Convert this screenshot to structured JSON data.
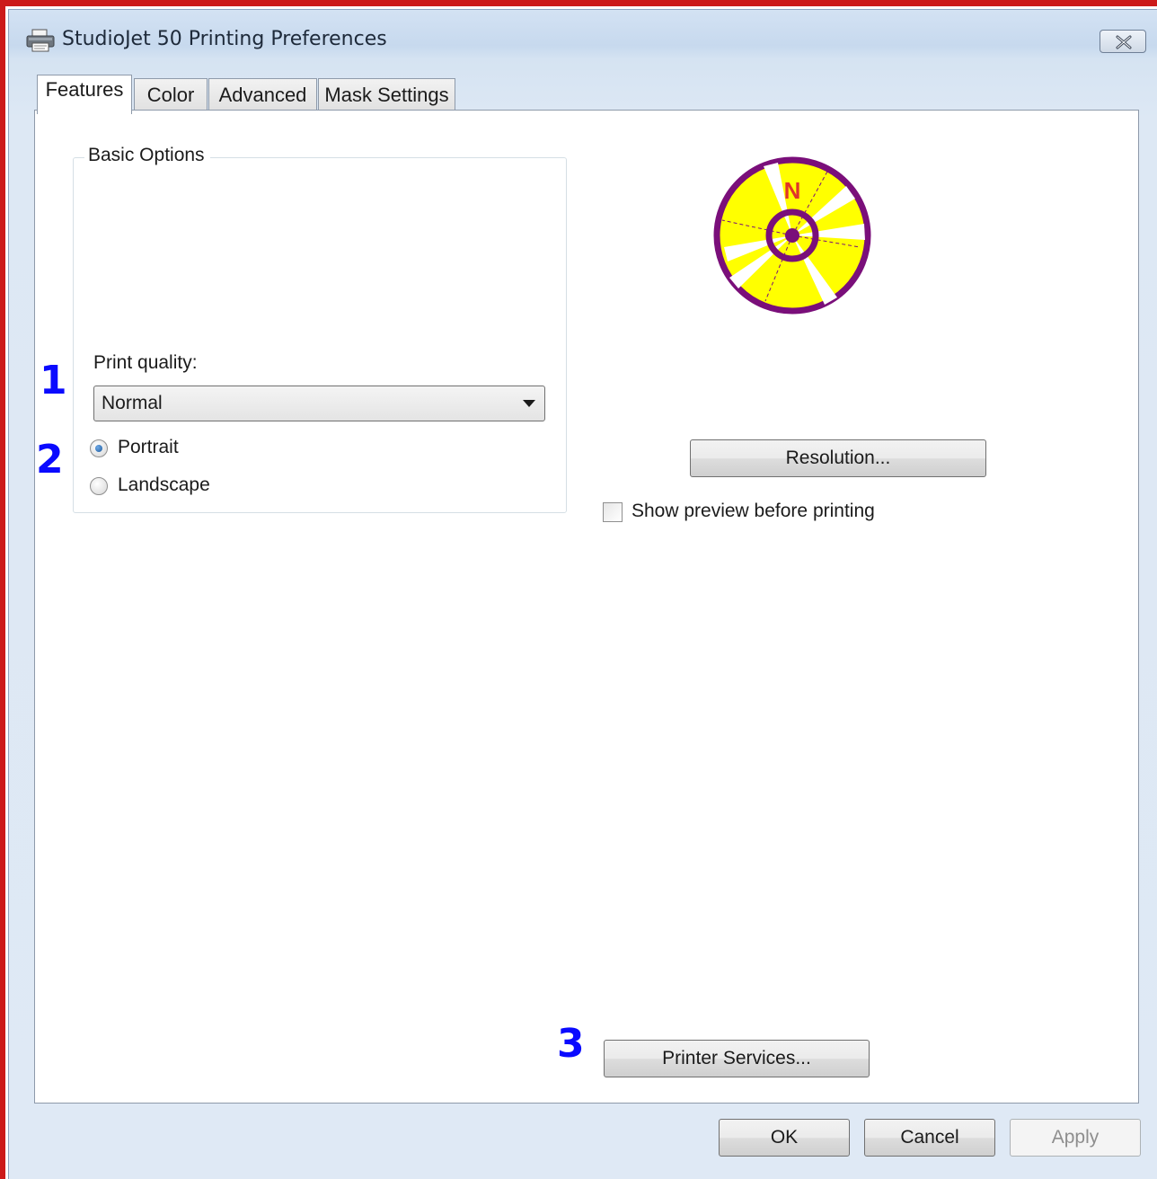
{
  "window": {
    "title": "StudioJet 50 Printing Preferences"
  },
  "tabs": [
    {
      "label": "Features",
      "active": true
    },
    {
      "label": "Color",
      "active": false
    },
    {
      "label": "Advanced",
      "active": false
    },
    {
      "label": "Mask Settings",
      "active": false
    }
  ],
  "basic_options": {
    "legend": "Basic Options",
    "print_quality_label": "Print quality:",
    "print_quality_value": "Normal",
    "orientation": [
      {
        "label": "Portrait",
        "selected": true
      },
      {
        "label": "Landscape",
        "selected": false
      }
    ]
  },
  "logo": {
    "letter": "N",
    "colors": {
      "ring": "#7a0f7a",
      "fill": "#ffff00",
      "letter": "#e0342a"
    }
  },
  "resolution_button": "Resolution...",
  "show_preview": {
    "label": "Show preview before printing",
    "checked": false
  },
  "printer_services_button": "Printer Services...",
  "footer": {
    "ok": "OK",
    "cancel": "Cancel",
    "apply": "Apply"
  },
  "annotations": [
    "1",
    "2",
    "3"
  ],
  "colors": {
    "frame_border": "#cc1a1a",
    "annotation": "#0a0aff",
    "radio_selected": "#1c5b9e"
  }
}
